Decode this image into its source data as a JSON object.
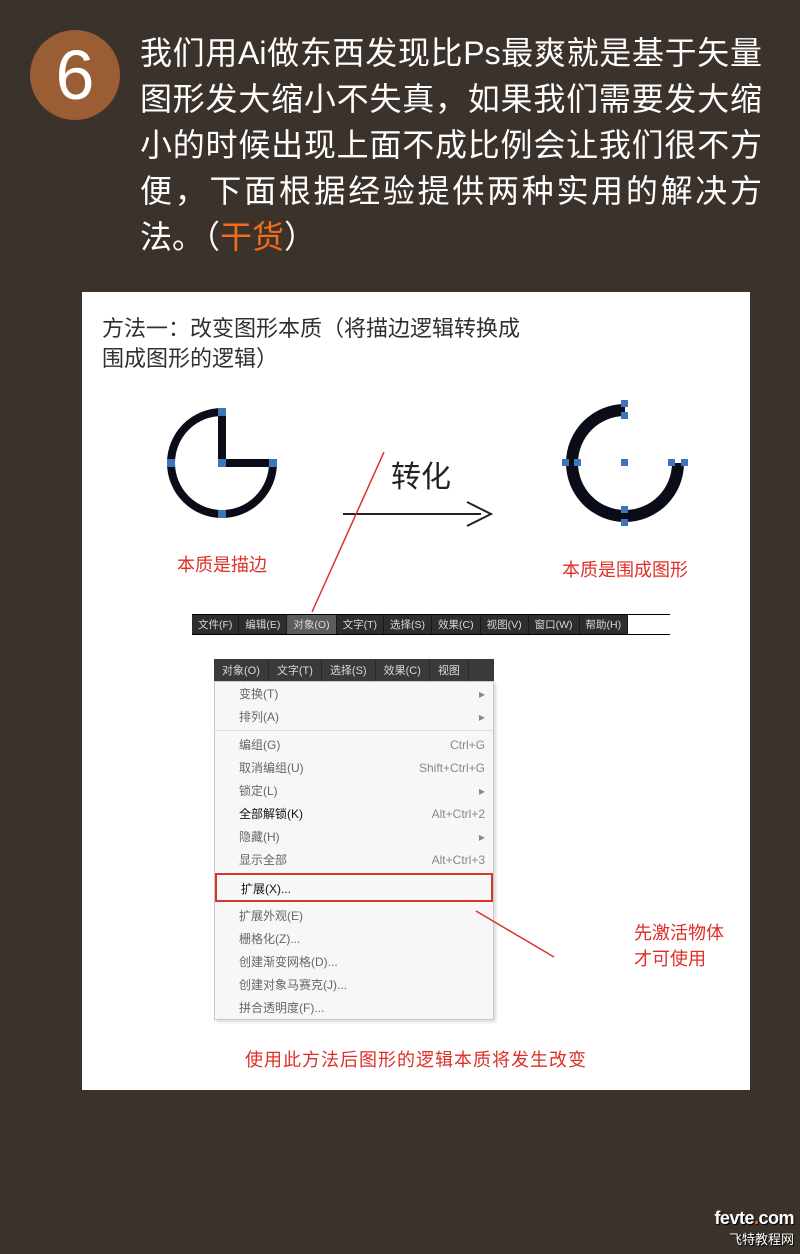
{
  "step_number": "6",
  "intro_before": "我们用Ai做东西发现比Ps最爽就是基于矢量图形发大缩小不失真，如果我们需要发大缩小的时候出现上面不成比例会让我们很不方便，下面根据经验提供两种实用的解决方法。（",
  "intro_highlight": "干货",
  "intro_after": "）",
  "method_title_l1": "方法一：改变图形本质（将描边逻辑转换成",
  "method_title_l2": "围成图形的逻辑）",
  "arrow_label": "转化",
  "caption_left": "本质是描边",
  "caption_right": "本质是围成图形",
  "topmenu": {
    "items": [
      "文件(F)",
      "编辑(E)",
      "对象(O)",
      "文字(T)",
      "选择(S)",
      "效果(C)",
      "视图(V)",
      "窗口(W)",
      "帮助(H)"
    ]
  },
  "dd_tabs": [
    "对象(O)",
    "文字(T)",
    "选择(S)",
    "效果(C)",
    "视图"
  ],
  "dd_items": [
    {
      "label": "变换(T)",
      "sub": "▸",
      "sep": false
    },
    {
      "label": "排列(A)",
      "sub": "▸",
      "sep": false
    },
    {
      "label": "编组(G)",
      "sub": "Ctrl+G",
      "sep": true
    },
    {
      "label": "取消编组(U)",
      "sub": "Shift+Ctrl+G",
      "sep": false
    },
    {
      "label": "锁定(L)",
      "sub": "▸",
      "sep": false
    },
    {
      "label": "全部解锁(K)",
      "sub": "Alt+Ctrl+2",
      "sep": false,
      "strong": true
    },
    {
      "label": "隐藏(H)",
      "sub": "▸",
      "sep": false
    },
    {
      "label": "显示全部",
      "sub": "Alt+Ctrl+3",
      "sep": false
    },
    {
      "label": "扩展(X)...",
      "sub": "",
      "sep": true,
      "boxed": true,
      "strong": true
    },
    {
      "label": "扩展外观(E)",
      "sub": "",
      "sep": false
    },
    {
      "label": "栅格化(Z)...",
      "sub": "",
      "sep": false
    },
    {
      "label": "创建渐变网格(D)...",
      "sub": "",
      "sep": false
    },
    {
      "label": "创建对象马赛克(J)...",
      "sub": "",
      "sep": false
    },
    {
      "label": "拼合透明度(F)...",
      "sub": "",
      "sep": false
    }
  ],
  "side_note": "先激活物体才可使用",
  "bottom_note": "使用此方法后图形的逻辑本质将发生改变",
  "watermark": {
    "brand_a": "fevte",
    "brand_dot": ".",
    "brand_b": "com",
    "sub": "飞特教程网"
  }
}
